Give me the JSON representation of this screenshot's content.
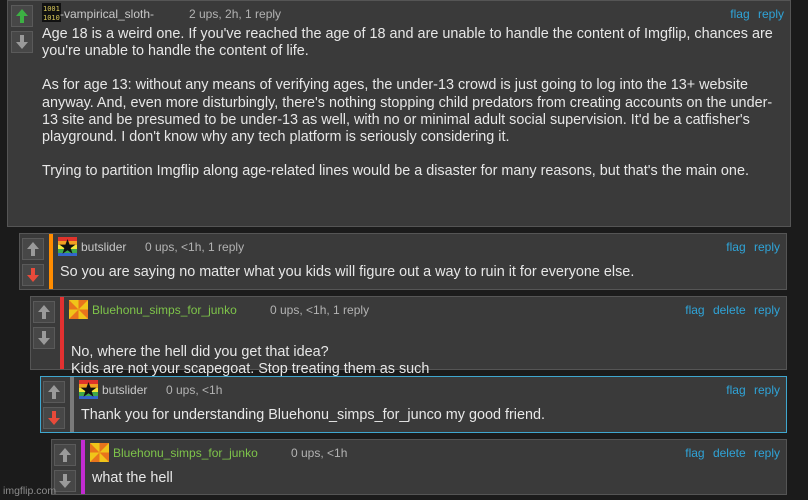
{
  "comments": [
    {
      "username": "-vampirical_sloth-",
      "meta": "2 ups, 2h, 1 reply",
      "actions": [
        "flag",
        "reply"
      ],
      "paragraphs": [
        "Age 18 is a weird one. If you've reached the age of 18 and are unable to handle the content of Imgflip, chances are you're unable to handle the content of life.",
        "As for age 13: without any means of verifying ages, the under-13 crowd is just going to log into the 13+ website anyway. And, even more disturbingly, there's nothing stopping child predators from creating accounts on the under-13 site and be presumed to be under-13 as well, with no or minimal adult social supervision. It'd be a catfisher's playground. I don't know why any tech platform is seriously considering it.",
        "Trying to partition Imgflip along age-related lines would be a disaster for many reasons, but that's the main one."
      ],
      "upvote_active": true
    },
    {
      "username": "butslider",
      "meta": "0 ups, <1h, 1 reply",
      "actions": [
        "flag",
        "reply"
      ],
      "paragraphs": [
        "So you are saying no matter what you kids will figure out a way to ruin it for everyone else."
      ],
      "downvote_active": true,
      "bar_color": "#ff8c00"
    },
    {
      "username": "Bluehonu_simps_for_junko",
      "meta": "0 ups, <1h, 1 reply",
      "actions": [
        "flag",
        "delete",
        "reply"
      ],
      "paragraphs": [
        "No, where the hell did you get that idea?\nKids are not your scapegoat. Stop treating them as such"
      ],
      "bar_color": "#e23131"
    },
    {
      "username": "butslider",
      "meta": "0 ups, <1h",
      "actions": [
        "flag",
        "reply"
      ],
      "paragraphs": [
        "Thank you for understanding Bluehonu_simps_for_junco my good friend."
      ],
      "downvote_active": true,
      "bar_color": "#7a7a7a"
    },
    {
      "username": "Bluehonu_simps_for_junko",
      "meta": "0 ups, <1h",
      "actions": [
        "flag",
        "delete",
        "reply"
      ],
      "paragraphs": [
        "what the hell"
      ],
      "bar_color": "#c22bd1"
    }
  ],
  "colors": {
    "upvote_active": "#3cb043",
    "downvote_active": "#e84a3a",
    "vote_inactive": "#9a9a9a",
    "username_default": "#c8c8c8",
    "username_green": "#7ec44a",
    "link": "#2fa4d8"
  },
  "icons": {
    "upvote": "up-arrow-icon",
    "downvote": "down-arrow-icon",
    "avatar_sloth": "binary-avatar-icon",
    "avatar_butslider": "star-avatar-icon",
    "avatar_bluehonu": "pinwheel-avatar-icon"
  },
  "watermark": "imgflip.com"
}
